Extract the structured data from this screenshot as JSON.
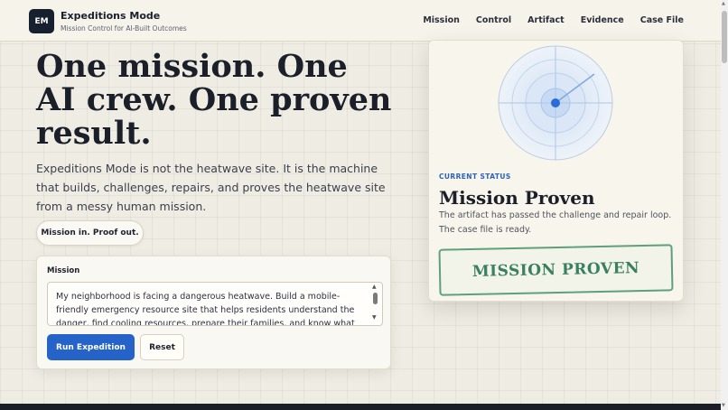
{
  "header": {
    "logo_text": "EM",
    "title": "Expeditions Mode",
    "subtitle": "Mission Control for AI-Built Outcomes",
    "nav": [
      {
        "label": "Mission"
      },
      {
        "label": "Control"
      },
      {
        "label": "Artifact"
      },
      {
        "label": "Evidence"
      },
      {
        "label": "Case File"
      }
    ]
  },
  "hero": {
    "title": "One mission. One AI crew. One proven result.",
    "description": "Expeditions Mode is not the heatwave site. It is the machine that builds, challenges, repairs, and proves the heatwave site from a messy human mission.",
    "pill": "Mission in. Proof out."
  },
  "mission": {
    "label": "Mission",
    "text": "My neighborhood is facing a dangerous heatwave. Build a mobile-friendly emergency resource site that helps residents understand the danger, find cooling resources, prepare their families, and know what to do in an emergency.",
    "run_button": "Run Expedition",
    "reset_button": "Reset"
  },
  "status": {
    "label": "CURRENT STATUS",
    "title": "Mission Proven",
    "description": "The artifact has passed the challenge and repair loop. The case file is ready.",
    "stamp": "MISSION PROVEN"
  },
  "colors": {
    "accent_blue": "#2563c9",
    "stamp_green": "#3a8060",
    "status_label": "#2d62b8",
    "background": "#efece3"
  },
  "icons": {
    "radar": "radar-icon"
  }
}
